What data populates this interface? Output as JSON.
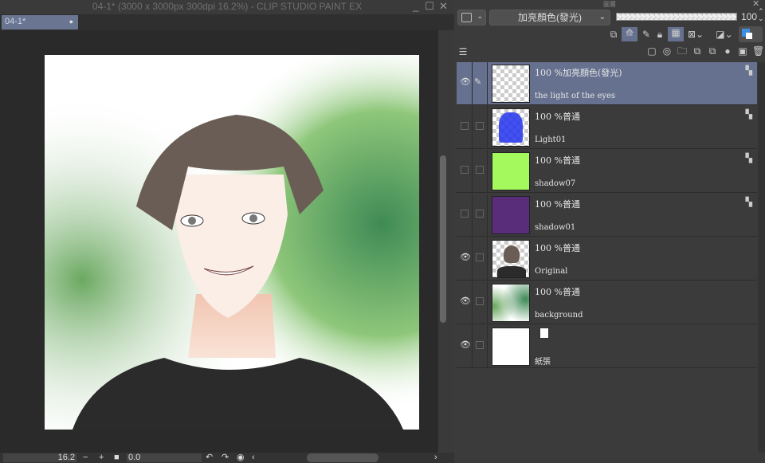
{
  "window": {
    "title": "04-1* (3000 x 3000px 300dpi 16.2%)  - CLIP STUDIO PAINT EX",
    "doc_tab": "04-1*"
  },
  "status": {
    "zoom": "16.2",
    "zoom_out": "−",
    "zoom_in": "+",
    "angle": "0.0"
  },
  "panel": {
    "title": "圖層",
    "blend_mode": "加亮顏色(發光)",
    "opacity": "100"
  },
  "layers": [
    {
      "mode": "100 %加亮顏色(發光)",
      "name": "the light of the eyes",
      "visible": true,
      "selected": true,
      "thumb": "transparent"
    },
    {
      "mode": "100 %普通",
      "name": "Light01",
      "visible": false,
      "thumb": "#2233ee"
    },
    {
      "mode": "100 %普通",
      "name": "shadow07",
      "visible": false,
      "thumb": "#a4fa5c"
    },
    {
      "mode": "100 %普通",
      "name": "shadow01",
      "visible": false,
      "thumb": "#5a2d7a"
    },
    {
      "mode": "100 %普通",
      "name": "Original",
      "visible": true,
      "thumb": "portrait"
    },
    {
      "mode": "100 %普通",
      "name": "background",
      "visible": true,
      "thumb": "trees"
    },
    {
      "mode": "",
      "name": "紙張",
      "visible": true,
      "thumb": "#ffffff"
    }
  ]
}
